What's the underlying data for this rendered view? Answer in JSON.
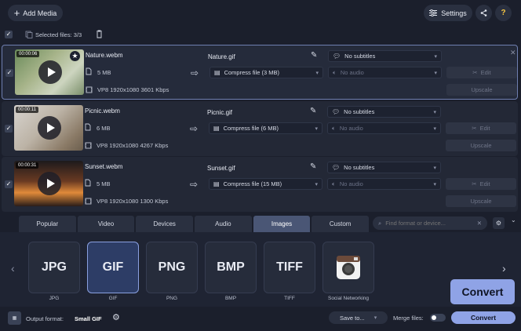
{
  "toolbar": {
    "add_media": "Add Media",
    "settings": "Settings",
    "help": "?"
  },
  "selection": {
    "label": "Selected files: 3/3"
  },
  "files": [
    {
      "time": "00:00:06",
      "name": "Nature.webm",
      "size": "5 MB",
      "codec": "VP8 1920x1080 3601 Kbps",
      "output": "Nature.gif",
      "compress": "Compress file (3 MB)",
      "subtitles": "No subtitles",
      "audio": "No audio",
      "edit": "Edit",
      "upscale": "Upscale"
    },
    {
      "time": "00:00:11",
      "name": "Picnic.webm",
      "size": "6 MB",
      "codec": "VP8 1920x1080 4267 Kbps",
      "output": "Picnic.gif",
      "compress": "Compress file (6 MB)",
      "subtitles": "No subtitles",
      "audio": "No audio",
      "edit": "Edit",
      "upscale": "Upscale"
    },
    {
      "time": "00:00:31",
      "name": "Sunset.webm",
      "size": "5 MB",
      "codec": "VP8 1920x1080 1300 Kbps",
      "output": "Sunset.gif",
      "compress": "Compress file (15 MB)",
      "subtitles": "No subtitles",
      "audio": "No audio",
      "edit": "Edit",
      "upscale": "Upscale"
    }
  ],
  "tabs": [
    "Popular",
    "Video",
    "Devices",
    "Audio",
    "Images",
    "Custom"
  ],
  "search": {
    "placeholder": "Find format or device..."
  },
  "formats": [
    {
      "badge": "JPG",
      "label": "JPG"
    },
    {
      "badge": "GIF",
      "label": "GIF"
    },
    {
      "badge": "PNG",
      "label": "PNG"
    },
    {
      "badge": "BMP",
      "label": "BMP"
    },
    {
      "badge": "TIFF",
      "label": "TIFF"
    },
    {
      "badge": "",
      "label": "Social Networking"
    }
  ],
  "bottom": {
    "output_label": "Output format:",
    "output_value": "Small GIF",
    "save_to": "Save to...",
    "merge": "Merge files:",
    "convert": "Convert"
  },
  "tooltip": {
    "convert": "Convert"
  },
  "colors": {
    "accent": "#8fa3e6",
    "background": "#1b1f2c"
  }
}
